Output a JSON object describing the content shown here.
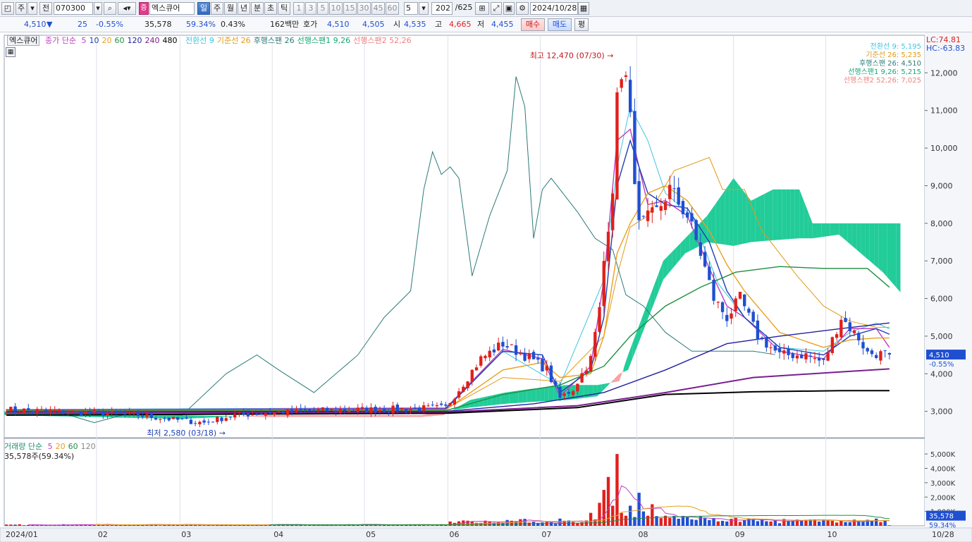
{
  "toolbar": {
    "period_select": "주",
    "code_type": "전",
    "stock_code": "070300",
    "stock_badge": "증",
    "stock_name": "엑스큐어",
    "periods": [
      "일",
      "주",
      "월",
      "년",
      "분",
      "초",
      "틱"
    ],
    "active_period": "일",
    "intervals": [
      "1",
      "3",
      "5",
      "10",
      "15",
      "30",
      "45",
      "60"
    ],
    "interval_value": "5",
    "count": "202",
    "total": "/625",
    "date": "2024/10/28"
  },
  "quote": {
    "price": "4,510",
    "change_arrow": "▼",
    "change": "25",
    "change_pct": "-0.55%",
    "volume": "35,578",
    "volume_ratio": "59.34%",
    "turnover": "0.43%",
    "amount": "162백만",
    "bid_label": "호가",
    "bid": "4,510",
    "ask": "4,505",
    "open_label": "시",
    "open": "4,535",
    "high_label": "고",
    "high": "4,665",
    "low_label": "저",
    "low": "4,455",
    "buy_label": "매수",
    "sell_label": "매도",
    "eval_label": "평"
  },
  "legend": {
    "name": "엑스큐어",
    "ma_label": "종가 단순",
    "ma_periods": [
      "5",
      "10",
      "20",
      "60",
      "120",
      "240",
      "480"
    ],
    "ichimoku": [
      "전환선 9",
      "기준선 26",
      "후행스팬 26",
      "선행스팬1 9,26",
      "선행스팬2 52,26"
    ]
  },
  "ichimoku_values": [
    {
      "text": "전환선 9: 5,195",
      "color": "#3ec6e0"
    },
    {
      "text": "기준선 26: 5,235",
      "color": "#e09a16"
    },
    {
      "text": "후행스팬 26: 4,510",
      "color": "#2b7a78"
    },
    {
      "text": "선행스팬1 9,26: 5,215",
      "color": "#12a876"
    },
    {
      "text": "선행스팬2 52,26: 7,025",
      "color": "#f08080"
    }
  ],
  "lc": "LC:74.81",
  "hc": "HC:-63.83",
  "colors": {
    "up": "#e0201c",
    "down": "#1f4fd1",
    "ma5": "#c040c0",
    "ma10": "#1f3fb5",
    "ma20": "#e8a020",
    "ma60": "#1f8f3f",
    "ma120": "#1f1fa0",
    "ma240": "#7a1f8f",
    "ma480": "#000000"
  },
  "chart_data": {
    "type": "candlestick",
    "x_ticks": [
      "2024/01",
      "02",
      "03",
      "04",
      "05",
      "06",
      "07",
      "08",
      "09",
      "10",
      "10/28"
    ],
    "y_ticks": [
      3000,
      4000,
      5000,
      6000,
      7000,
      8000,
      9000,
      10000,
      11000,
      12000
    ],
    "ylim": [
      2300,
      12700
    ],
    "current_price": {
      "value": 4510,
      "label": "4,510",
      "change": "-0.55%"
    },
    "high_annotation": "최고 12,470 (07/30)",
    "low_annotation": "최저 2,580 (03/18)",
    "anchors": [
      [
        0,
        3050
      ],
      [
        18,
        2970
      ],
      [
        30,
        2900
      ],
      [
        38,
        2780
      ],
      [
        45,
        2700
      ],
      [
        52,
        2900
      ],
      [
        62,
        2980
      ],
      [
        75,
        3040
      ],
      [
        85,
        3050
      ],
      [
        100,
        3100
      ],
      [
        108,
        4400
      ],
      [
        113,
        4800
      ],
      [
        120,
        4350
      ],
      [
        123,
        4100
      ],
      [
        126,
        3350
      ],
      [
        129,
        3600
      ],
      [
        133,
        4400
      ],
      [
        135,
        5700
      ],
      [
        136,
        7000
      ],
      [
        138,
        9000
      ],
      [
        139,
        11200
      ],
      [
        140,
        12100
      ],
      [
        141,
        11800
      ],
      [
        142,
        10700
      ],
      [
        144,
        7900
      ],
      [
        148,
        8300
      ],
      [
        151,
        8900
      ],
      [
        155,
        8200
      ],
      [
        158,
        7200
      ],
      [
        161,
        6000
      ],
      [
        164,
        5500
      ],
      [
        167,
        6000
      ],
      [
        171,
        5000
      ],
      [
        176,
        4500
      ],
      [
        182,
        4500
      ],
      [
        186,
        4300
      ],
      [
        190,
        5500
      ],
      [
        194,
        4950
      ],
      [
        196,
        4550
      ],
      [
        201,
        4510
      ]
    ],
    "moving_averages": [
      {
        "name": "5",
        "color": "#c040c0",
        "points": [
          [
            0,
            3040
          ],
          [
            100,
            3080
          ],
          [
            113,
            4650
          ],
          [
            122,
            4400
          ],
          [
            126,
            3400
          ],
          [
            133,
            4200
          ],
          [
            136,
            6500
          ],
          [
            139,
            10200
          ],
          [
            142,
            10500
          ],
          [
            146,
            8500
          ],
          [
            150,
            8600
          ],
          [
            155,
            8200
          ],
          [
            160,
            6800
          ],
          [
            164,
            5800
          ],
          [
            168,
            5500
          ],
          [
            176,
            4600
          ],
          [
            186,
            4400
          ],
          [
            192,
            5200
          ],
          [
            198,
            5200
          ],
          [
            201,
            4700
          ]
        ]
      },
      {
        "name": "10",
        "color": "#1f3fb5",
        "points": [
          [
            0,
            3030
          ],
          [
            100,
            3060
          ],
          [
            113,
            4600
          ],
          [
            122,
            4500
          ],
          [
            126,
            3500
          ],
          [
            133,
            4100
          ],
          [
            136,
            5500
          ],
          [
            139,
            9000
          ],
          [
            142,
            10200
          ],
          [
            146,
            8800
          ],
          [
            150,
            8500
          ],
          [
            155,
            8400
          ],
          [
            160,
            7500
          ],
          [
            164,
            6200
          ],
          [
            168,
            5500
          ],
          [
            176,
            4700
          ],
          [
            186,
            4500
          ],
          [
            192,
            5000
          ],
          [
            198,
            5200
          ],
          [
            201,
            5050
          ]
        ]
      },
      {
        "name": "20",
        "color": "#e8a020",
        "points": [
          [
            0,
            3020
          ],
          [
            100,
            3040
          ],
          [
            113,
            4100
          ],
          [
            122,
            4300
          ],
          [
            126,
            3900
          ],
          [
            133,
            4000
          ],
          [
            136,
            5000
          ],
          [
            139,
            7200
          ],
          [
            142,
            8000
          ],
          [
            146,
            8800
          ],
          [
            150,
            9000
          ],
          [
            155,
            8600
          ],
          [
            160,
            7800
          ],
          [
            164,
            6900
          ],
          [
            168,
            6200
          ],
          [
            176,
            5100
          ],
          [
            186,
            4700
          ],
          [
            192,
            4900
          ],
          [
            198,
            4950
          ],
          [
            201,
            4950
          ]
        ]
      },
      {
        "name": "60",
        "color": "#1f8f3f",
        "points": [
          [
            0,
            3010
          ],
          [
            100,
            3020
          ],
          [
            113,
            3450
          ],
          [
            126,
            3700
          ],
          [
            136,
            4200
          ],
          [
            142,
            5000
          ],
          [
            150,
            5800
          ],
          [
            158,
            6300
          ],
          [
            166,
            6700
          ],
          [
            176,
            6850
          ],
          [
            186,
            6800
          ],
          [
            196,
            6800
          ],
          [
            201,
            6300
          ]
        ]
      },
      {
        "name": "120",
        "color": "#1f1fa0",
        "points": [
          [
            0,
            2990
          ],
          [
            100,
            3000
          ],
          [
            120,
            3200
          ],
          [
            136,
            3500
          ],
          [
            150,
            4100
          ],
          [
            164,
            4800
          ],
          [
            176,
            5000
          ],
          [
            190,
            5200
          ],
          [
            201,
            5350
          ]
        ]
      },
      {
        "name": "240",
        "color": "#7a1f8f",
        "points": [
          [
            0,
            2950
          ],
          [
            100,
            2980
          ],
          [
            130,
            3150
          ],
          [
            150,
            3500
          ],
          [
            170,
            3900
          ],
          [
            190,
            4050
          ],
          [
            201,
            4130
          ]
        ]
      },
      {
        "name": "480",
        "color": "#000000",
        "points": [
          [
            0,
            2900
          ],
          [
            100,
            2950
          ],
          [
            130,
            3100
          ],
          [
            150,
            3450
          ],
          [
            170,
            3520
          ],
          [
            190,
            3550
          ],
          [
            201,
            3550
          ]
        ]
      }
    ],
    "ichimoku_lines": [
      {
        "name": "전환선 9",
        "color": "#3ec6e0",
        "points": [
          [
            0,
            3050
          ],
          [
            100,
            3100
          ],
          [
            113,
            4600
          ],
          [
            126,
            3700
          ],
          [
            136,
            6500
          ],
          [
            139,
            9500
          ],
          [
            142,
            11100
          ],
          [
            146,
            10200
          ],
          [
            150,
            8800
          ],
          [
            156,
            8200
          ],
          [
            162,
            6400
          ],
          [
            168,
            5500
          ],
          [
            176,
            4700
          ],
          [
            186,
            4600
          ],
          [
            192,
            5100
          ],
          [
            198,
            5350
          ],
          [
            201,
            5195
          ]
        ]
      },
      {
        "name": "기준선 26",
        "color": "#e09a16",
        "points": [
          [
            0,
            3040
          ],
          [
            100,
            3060
          ],
          [
            113,
            3900
          ],
          [
            126,
            3800
          ],
          [
            136,
            5000
          ],
          [
            139,
            6600
          ],
          [
            142,
            7900
          ],
          [
            146,
            8200
          ],
          [
            152,
            9400
          ],
          [
            160,
            9750
          ],
          [
            163,
            8900
          ],
          [
            168,
            8900
          ],
          [
            172,
            7800
          ],
          [
            180,
            6600
          ],
          [
            186,
            5800
          ],
          [
            192,
            5400
          ],
          [
            198,
            5235
          ],
          [
            201,
            5235
          ]
        ]
      },
      {
        "name": "후행스팬 26",
        "color": "#2b7a78",
        "points": [
          [
            0,
            3050
          ],
          [
            12,
            2980
          ],
          [
            20,
            2700
          ],
          [
            28,
            2950
          ],
          [
            40,
            2900
          ],
          [
            50,
            4000
          ],
          [
            57,
            4500
          ],
          [
            62,
            4100
          ],
          [
            70,
            3500
          ],
          [
            80,
            4500
          ],
          [
            86,
            5500
          ],
          [
            92,
            6200
          ],
          [
            95,
            8900
          ],
          [
            97,
            9900
          ],
          [
            99,
            9300
          ],
          [
            101,
            9500
          ],
          [
            103,
            9200
          ],
          [
            106,
            6600
          ],
          [
            110,
            8200
          ],
          [
            114,
            9400
          ],
          [
            116,
            11900
          ],
          [
            118,
            11100
          ],
          [
            120,
            7600
          ],
          [
            122,
            8900
          ],
          [
            124,
            9200
          ],
          [
            126,
            8900
          ],
          [
            130,
            8300
          ],
          [
            134,
            7600
          ],
          [
            138,
            7300
          ],
          [
            141,
            6100
          ],
          [
            145,
            5800
          ],
          [
            150,
            5100
          ],
          [
            156,
            4600
          ],
          [
            162,
            4600
          ],
          [
            170,
            4600
          ],
          [
            175,
            4510
          ]
        ]
      }
    ],
    "cloud": {
      "span1": [
        [
          0,
          3000
        ],
        [
          40,
          2900
        ],
        [
          60,
          2850
        ],
        [
          95,
          2850
        ],
        [
          100,
          2900
        ],
        [
          106,
          3300
        ],
        [
          114,
          3500
        ],
        [
          120,
          3600
        ],
        [
          128,
          3700
        ],
        [
          135,
          3700
        ],
        [
          140,
          3800
        ],
        [
          142,
          4500
        ],
        [
          150,
          7000
        ],
        [
          155,
          7600
        ],
        [
          160,
          8200
        ],
        [
          166,
          9200
        ],
        [
          170,
          8600
        ],
        [
          175,
          8900
        ],
        [
          181,
          8900
        ],
        [
          184,
          8000
        ],
        [
          190,
          8000
        ],
        [
          200,
          8000
        ],
        [
          206,
          8000
        ]
      ],
      "span2": [
        [
          0,
          2900
        ],
        [
          40,
          2800
        ],
        [
          60,
          2900
        ],
        [
          95,
          2900
        ],
        [
          100,
          3000
        ],
        [
          106,
          3100
        ],
        [
          114,
          3200
        ],
        [
          120,
          3250
        ],
        [
          128,
          3300
        ],
        [
          135,
          3400
        ],
        [
          140,
          4000
        ],
        [
          142,
          4100
        ],
        [
          150,
          6500
        ],
        [
          155,
          7200
        ],
        [
          160,
          7500
        ],
        [
          166,
          7400
        ],
        [
          170,
          7500
        ],
        [
          175,
          7550
        ],
        [
          181,
          7600
        ],
        [
          184,
          7600
        ],
        [
          190,
          7700
        ],
        [
          200,
          6700
        ],
        [
          206,
          5900
        ]
      ]
    },
    "volume": {
      "title": "거래량 단순",
      "ma_periods": [
        "5",
        "20",
        "60",
        "120"
      ],
      "current": "35,578주(59.34%)",
      "y_ticks": [
        1000,
        2000,
        3000,
        4000,
        5000
      ],
      "y_tick_labels": [
        "1,000K",
        "2,000K",
        "3,000K",
        "4,000K",
        "5,000K"
      ],
      "ylim": [
        0,
        5400
      ],
      "current_label": "35,578",
      "current_ratio": "59.34%"
    }
  }
}
